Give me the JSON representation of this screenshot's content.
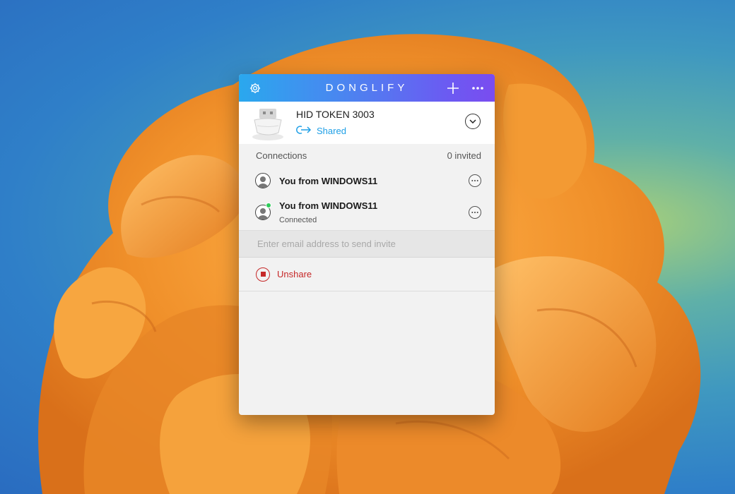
{
  "window": {
    "app_title": "DONGLIFY",
    "icons": {
      "settings": "gear-icon",
      "add": "plus-icon",
      "more": "more-horizontal-icon"
    }
  },
  "device": {
    "name": "HID TOKEN 3003",
    "status": "Shared",
    "status_icon": "share-arrow-icon",
    "image": "usb-token-icon"
  },
  "connections": {
    "label": "Connections",
    "invited": "0 invited",
    "items": [
      {
        "name": "You from WINDOWS11",
        "status": "",
        "online": false
      },
      {
        "name": "You from WINDOWS11",
        "status": "Connected",
        "online": true
      }
    ]
  },
  "invite": {
    "placeholder": "Enter email address to send invite",
    "value": ""
  },
  "actions": {
    "unshare": "Unshare"
  },
  "colors": {
    "accent": "#1e9fe6",
    "danger": "#c62828",
    "online": "#2ecc5a",
    "title_gradient_start": "#2aa8ee",
    "title_gradient_end": "#7a4cf0",
    "wallpaper_flower": "#f29a2e"
  }
}
